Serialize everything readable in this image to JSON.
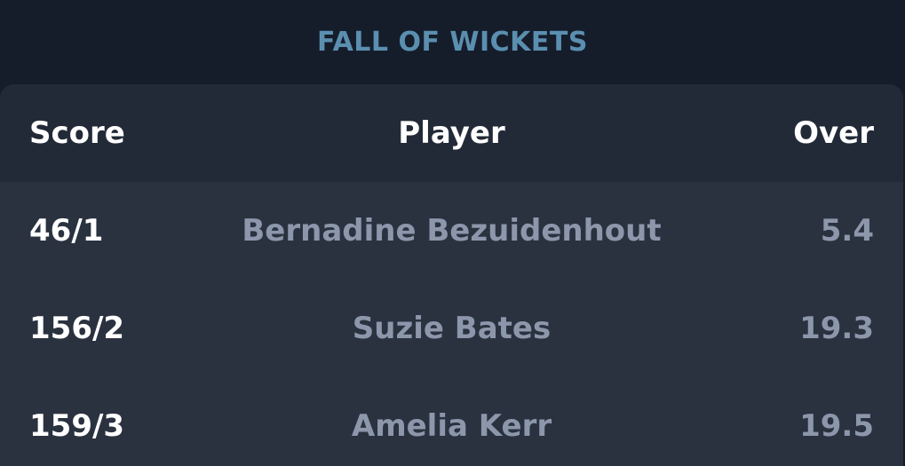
{
  "section": {
    "title": "FALL OF WICKETS"
  },
  "table": {
    "headers": {
      "score": "Score",
      "player": "Player",
      "over": "Over"
    },
    "rows": [
      {
        "score": "46/1",
        "player": "Bernadine Bezuidenhout",
        "over": "5.4"
      },
      {
        "score": "156/2",
        "player": "Suzie Bates",
        "over": "19.3"
      },
      {
        "score": "159/3",
        "player": "Amelia Kerr",
        "over": "19.5"
      }
    ]
  },
  "colors": {
    "background": "#151d2b",
    "card": "#2a3240",
    "header": "#222a38",
    "title_accent": "#5b8fb0",
    "muted_text": "#8d97ab"
  }
}
